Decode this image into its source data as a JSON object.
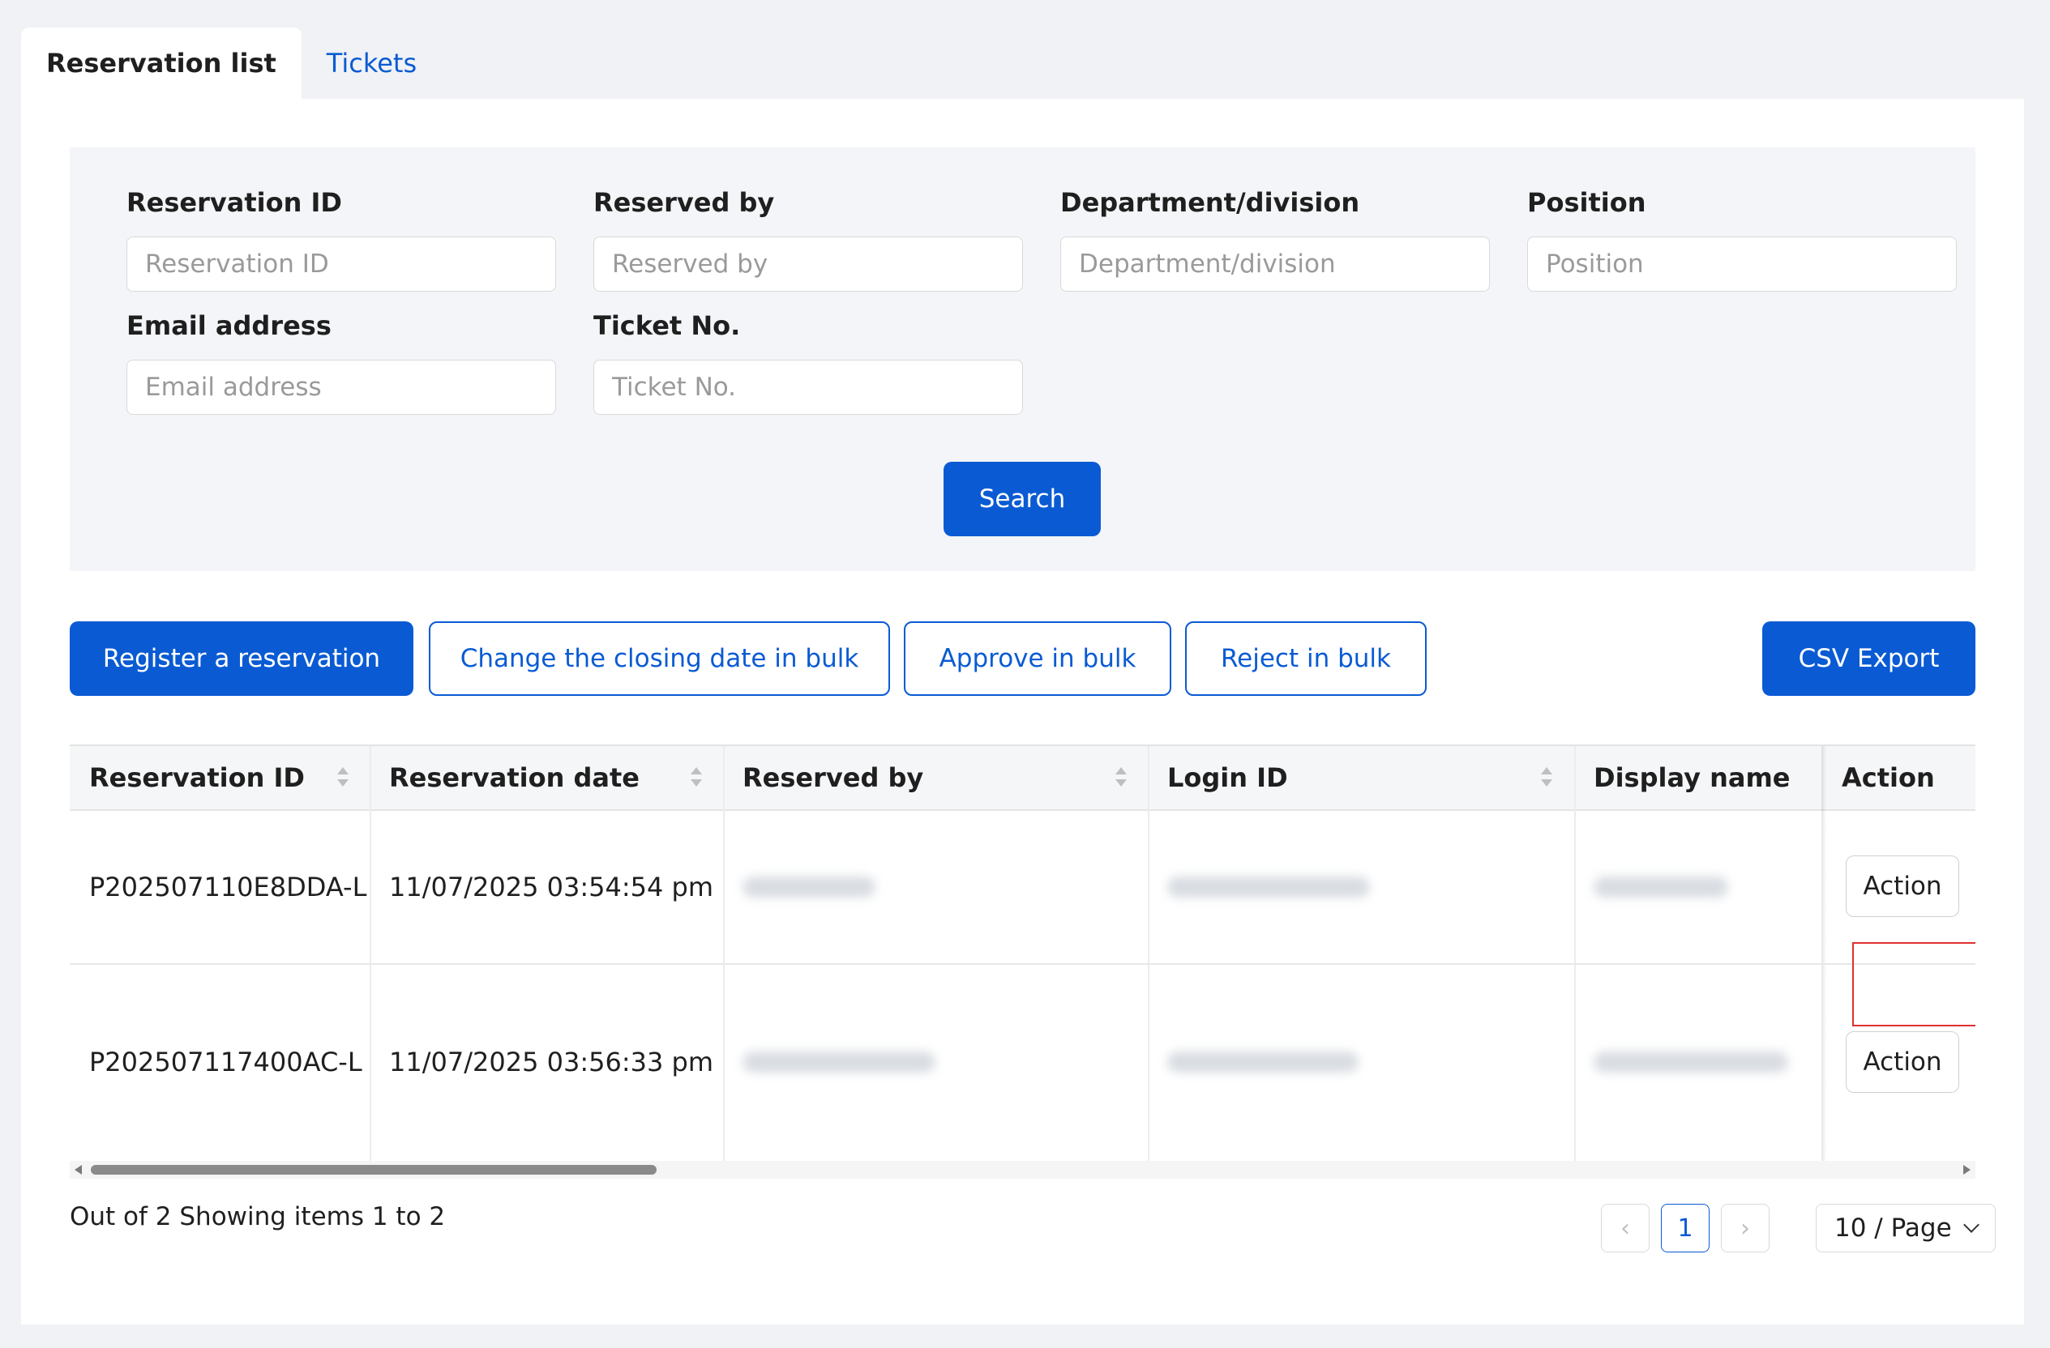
{
  "tabs": [
    {
      "label": "Reservation list",
      "active": true
    },
    {
      "label": "Tickets",
      "active": false
    }
  ],
  "search": {
    "fields": [
      {
        "label": "Reservation ID",
        "placeholder": "Reservation ID"
      },
      {
        "label": "Reserved by",
        "placeholder": "Reserved by"
      },
      {
        "label": "Department/division",
        "placeholder": "Department/division"
      },
      {
        "label": "Position",
        "placeholder": "Position"
      },
      {
        "label": "Email address",
        "placeholder": "Email address"
      },
      {
        "label": "Ticket No.",
        "placeholder": "Ticket No."
      }
    ],
    "search_label": "Search"
  },
  "toolbar": {
    "register_label": "Register a reservation",
    "change_closing_label": "Change the closing date in bulk",
    "approve_label": "Approve in bulk",
    "reject_label": "Reject in bulk",
    "csv_label": "CSV Export"
  },
  "table": {
    "columns": [
      "Reservation ID",
      "Reservation date",
      "Reserved by",
      "Login ID",
      "Display name",
      "Action"
    ],
    "rows": [
      {
        "reservation_id": "P202507110E8DDA-L",
        "reservation_date": "11/07/2025 03:54:54 pm",
        "action": "Action"
      },
      {
        "reservation_id": "P202507117400AC-L",
        "reservation_date": "11/07/2025 03:56:33 pm",
        "action": "Action"
      }
    ]
  },
  "pagination": {
    "summary": "Out of 2 Showing items 1 to 2",
    "current_page": "1",
    "page_size": "10 / Page"
  },
  "colors": {
    "primary": "#0a5bd3",
    "highlight": "#e03030"
  }
}
